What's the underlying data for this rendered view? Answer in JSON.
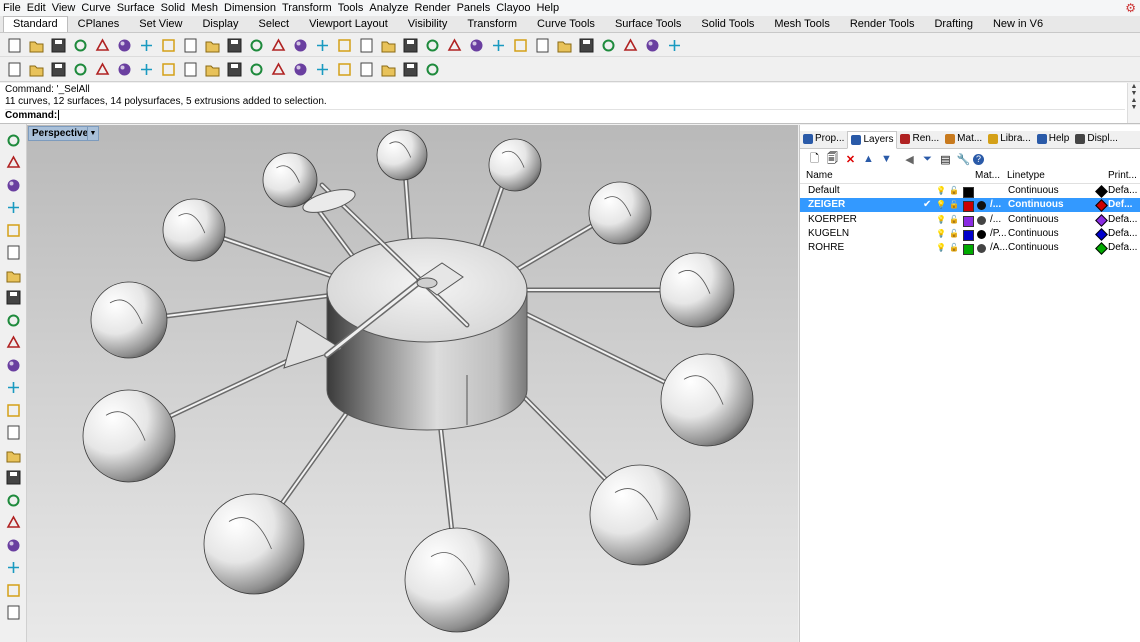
{
  "menu": [
    "File",
    "Edit",
    "View",
    "Curve",
    "Surface",
    "Solid",
    "Mesh",
    "Dimension",
    "Transform",
    "Tools",
    "Analyze",
    "Render",
    "Panels",
    "Clayoo",
    "Help"
  ],
  "tabs": [
    {
      "label": "Standard",
      "active": true
    },
    {
      "label": "CPlanes"
    },
    {
      "label": "Set View"
    },
    {
      "label": "Display"
    },
    {
      "label": "Select"
    },
    {
      "label": "Viewport Layout"
    },
    {
      "label": "Visibility"
    },
    {
      "label": "Transform"
    },
    {
      "label": "Curve Tools"
    },
    {
      "label": "Surface Tools"
    },
    {
      "label": "Solid Tools"
    },
    {
      "label": "Mesh Tools"
    },
    {
      "label": "Render Tools"
    },
    {
      "label": "Drafting"
    },
    {
      "label": "New in V6"
    }
  ],
  "command": {
    "history_1": "Command: '_SelAll",
    "history_2": "11 curves, 12 surfaces, 14 polysurfaces, 5 extrusions added to selection.",
    "prompt": "Command:"
  },
  "viewport": {
    "label": "Perspective"
  },
  "panel": {
    "tabs": [
      "Prop...",
      "Layers",
      "Ren...",
      "Mat...",
      "Libra...",
      "Help",
      "Displ..."
    ],
    "active_tab": "Layers",
    "columns": {
      "name": "Name",
      "material": "Mat...",
      "linetype": "Linetype",
      "print": "Print..."
    },
    "layers": [
      {
        "name": "Default",
        "linetype": "Continuous",
        "print": "Defa...",
        "color": "#000000",
        "material_label": "",
        "print_color": "#000000",
        "selected": false
      },
      {
        "name": "ZEIGER",
        "linetype": "Continuous",
        "print": "Def...",
        "color": "#cc0000",
        "material_label": "/...",
        "print_color": "#cc0000",
        "selected": true
      },
      {
        "name": "KOERPER",
        "linetype": "Continuous",
        "print": "Defa...",
        "color": "#8a2be2",
        "material_label": "/...",
        "print_color": "#8a2be2",
        "selected": false
      },
      {
        "name": "KUGELN",
        "linetype": "Continuous",
        "print": "Defa...",
        "color": "#0000cc",
        "material_label": "/P...",
        "print_color": "#0000cc",
        "selected": false
      },
      {
        "name": "ROHRE",
        "linetype": "Continuous",
        "print": "Defa...",
        "color": "#00aa00",
        "material_label": "/A...",
        "print_color": "#00aa00",
        "selected": false
      }
    ]
  },
  "icons": {
    "toolbar1": [
      "new-icon",
      "open-icon",
      "save-icon",
      "print-icon",
      "import-icon",
      "cut-icon",
      "copy-icon",
      "paste-icon",
      "undo-icon",
      "redo-icon",
      "pan-icon",
      "zoom-icon",
      "zoom-window-icon",
      "zoom-extents-icon",
      "zoom-selected-icon",
      "rotate-view-icon",
      "four-viewports-icon",
      "car-icon",
      "select-points-icon",
      "grid-snap-icon",
      "light-icon",
      "lock-icon",
      "layer-icon",
      "color-wheel-icon",
      "shaded-sphere-icon",
      "rendered-sphere-icon",
      "render-icon",
      "settings-icon",
      "group-icon",
      "globe-icon",
      "help-icon"
    ],
    "toolbar2": [
      "check-icon",
      "teapot-icon",
      "teapot-2-icon",
      "lasso-icon",
      "ring-icon",
      "circle-target-icon",
      "triangle-icon",
      "t-tool-icon",
      "sun-half-icon",
      "gear-round-icon",
      "sun-icon",
      "diagonal-icon",
      "cube-wire-icon",
      "box-icon",
      "cube-3d-icon",
      "tree-icon",
      "scissors-icon",
      "grid-ball-icon",
      "lines-icon",
      "crosshair-icon"
    ],
    "left": [
      "select-arrow-icon",
      "point-icon",
      "polyline-icon",
      "curve-icon",
      "circle-icon",
      "ellipse-icon",
      "arc-icon",
      "rectangle-icon",
      "polygon-icon",
      "fillet-icon",
      "surface-icon",
      "extrude-icon",
      "box-solid-icon",
      "sphere-solid-icon",
      "mesh-icon",
      "solid-edit-icon",
      "group-tool-icon",
      "move-icon",
      "scale-icon",
      "boolean-icon",
      "spheres-icon",
      "snap-icon"
    ]
  }
}
